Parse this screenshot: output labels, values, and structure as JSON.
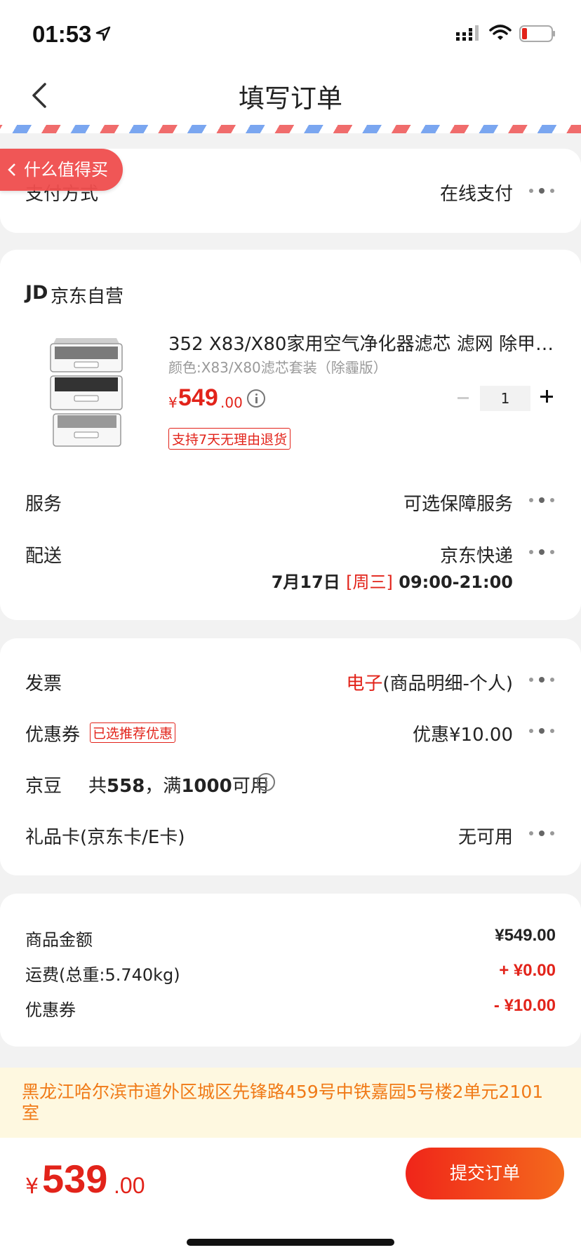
{
  "status_bar": {
    "time": "01:53"
  },
  "nav": {
    "title": "填写订单"
  },
  "float_tag": {
    "label": "什么值得买"
  },
  "payment": {
    "label": "支付方式",
    "value": "在线支付"
  },
  "store": {
    "logo": "JD",
    "name": "京东自营"
  },
  "product": {
    "title": "352 X83/X80家用空气净化器滤芯 滤网 除甲…",
    "spec": "颜色:X83/X80滤芯套装（除霾版）",
    "price_currency": "¥",
    "price_int": "549",
    "price_dec": ".00",
    "quantity": "1",
    "return_badge": "支持7天无理由退货"
  },
  "service": {
    "label": "服务",
    "value": "可选保障服务"
  },
  "delivery": {
    "label": "配送",
    "value": "京东快递",
    "date": "7月17日",
    "weekday": "[周三]",
    "time_range": "09:00-21:00"
  },
  "invoice": {
    "label": "发票",
    "type": "电子",
    "detail": "(商品明细-个人)"
  },
  "coupon": {
    "label": "优惠券",
    "badge": "已选推荐优惠",
    "value": "优惠¥10.00"
  },
  "jingdou": {
    "label": "京豆",
    "text_prefix": "共",
    "count": "558",
    "text_mid": "，满",
    "threshold": "1000",
    "text_suffix": "可用"
  },
  "gift_card": {
    "label": "礼品卡(京东卡/E卡)",
    "value": "无可用"
  },
  "summary": {
    "rows": [
      {
        "label": "商品金额",
        "value": "¥549.00"
      },
      {
        "label": "运费(总重:5.740kg)",
        "value": "+ ¥0.00"
      },
      {
        "label": "优惠券",
        "value": "- ¥10.00"
      }
    ]
  },
  "address": {
    "text": "黑龙江哈尔滨市道外区城区先锋路459号中铁嘉园5号楼2单元2101室"
  },
  "total": {
    "currency": "¥",
    "int": "539",
    "dec": ".00"
  },
  "submit": {
    "label": "提交订单"
  },
  "colors": {
    "accent": "#e2231a",
    "address_bg": "#fef8e0",
    "address_text": "#f07a17"
  }
}
